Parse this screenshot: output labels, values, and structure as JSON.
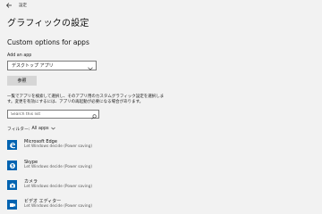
{
  "window": {
    "app_title": "設定"
  },
  "page": {
    "title": "グラフィックの設定"
  },
  "custom": {
    "section_title": "Custom options for apps",
    "add_app_label": "Add an app",
    "dropdown_value": "デスクトップ アプリ",
    "browse_label": "参照",
    "description_line1": "一覧でアプリを検索して選択し、そのアプリ用のカスタムグラフィック設定を選択しま",
    "description_line2": "す。変更を有効にするには、アプリの再起動が必要になる場合があります。"
  },
  "search": {
    "placeholder": "Search this list"
  },
  "filter": {
    "label": "フィルター:",
    "value": "All apps"
  },
  "apps": [
    {
      "name": "Microsoft Edge",
      "status": "Let Windows decide (Power saving)",
      "icon": "edge-icon"
    },
    {
      "name": "Skype",
      "status": "Let Windows decide (Power saving)",
      "icon": "skype-icon"
    },
    {
      "name": "カメラ",
      "status": "Let Windows decide (Power saving)",
      "icon": "camera-icon"
    },
    {
      "name": "ビデオ エディター",
      "status": "Let Windows decide (Power saving)",
      "icon": "video-editor-icon"
    }
  ],
  "colors": {
    "background": "#f2f2f2",
    "accent": "#0063b1"
  }
}
